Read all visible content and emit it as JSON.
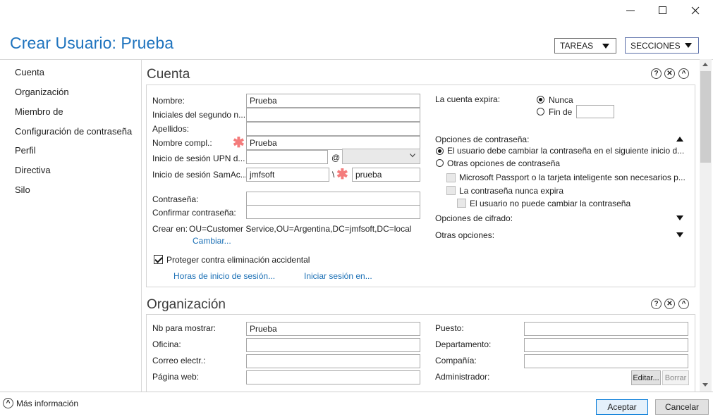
{
  "window": {
    "minimize": "—",
    "maximize": "□",
    "close": "✕"
  },
  "header": {
    "title": "Crear Usuario: Prueba",
    "tasks_label": "TAREAS",
    "sections_label": "SECCIONES"
  },
  "nav": {
    "items": [
      {
        "label": "Cuenta"
      },
      {
        "label": "Organización"
      },
      {
        "label": "Miembro de"
      },
      {
        "label": "Configuración de contraseña"
      },
      {
        "label": "Perfil"
      },
      {
        "label": "Directiva"
      },
      {
        "label": "Silo"
      }
    ]
  },
  "section_icons": {
    "help": "?",
    "close": "✕",
    "collapse": "^"
  },
  "cuenta": {
    "title": "Cuenta",
    "fields": {
      "nombre": {
        "label": "Nombre:",
        "value": "Prueba"
      },
      "iniciales": {
        "label": "Iniciales del segundo n...",
        "value": ""
      },
      "apellidos": {
        "label": "Apellidos:",
        "value": ""
      },
      "nombre_compl": {
        "label": "Nombre compl.:",
        "value": "Prueba"
      },
      "upn": {
        "label": "Inicio de sesión UPN d...",
        "value": "",
        "at": "@",
        "domain": ""
      },
      "sam": {
        "label": "Inicio de sesión SamAc...",
        "domain": "jmfsoft",
        "sep": "\\",
        "value": "prueba"
      },
      "password": {
        "label": "Contraseña:",
        "value": ""
      },
      "confirm_password": {
        "label": "Confirmar contraseña:",
        "value": ""
      }
    },
    "crear_en": {
      "label": "Crear en:",
      "value": "OU=Customer Service,OU=Argentina,DC=jmfsoft,DC=local",
      "change_link": "Cambiar..."
    },
    "protect": {
      "label": "Proteger contra eliminación accidental",
      "checked": true
    },
    "links": {
      "logon_hours": "Horas de inicio de sesión...",
      "logon_to": "Iniciar sesión en..."
    },
    "expires": {
      "label": "La cuenta expira:",
      "never": "Nunca",
      "end_of": "Fin de",
      "end_of_value": "",
      "selected": "never"
    },
    "password_options": {
      "title": "Opciones de contraseña:",
      "must_change": "El usuario debe cambiar la contraseña en el siguiente inicio d...",
      "other": "Otras opciones de contraseña",
      "smartcard": "Microsoft Passport o la tarjeta inteligente son necesarios p...",
      "never_expires": "La contraseña nunca expira",
      "cannot_change": "El usuario no puede cambiar la contraseña",
      "selected": "must_change"
    },
    "encryption_options": "Opciones de cifrado:",
    "other_options": "Otras opciones:"
  },
  "organizacion": {
    "title": "Organización",
    "display_name": {
      "label": "Nb para mostrar:",
      "value": "Prueba"
    },
    "office": {
      "label": "Oficina:",
      "value": ""
    },
    "email": {
      "label": "Correo electr.:",
      "value": ""
    },
    "web": {
      "label": "Página web:",
      "value": ""
    },
    "job_title": {
      "label": "Puesto:",
      "value": ""
    },
    "department": {
      "label": "Departamento:",
      "value": ""
    },
    "company": {
      "label": "Compañía:",
      "value": ""
    },
    "manager": {
      "label": "Administrador:",
      "edit": "Editar...",
      "clear": "Borrar"
    }
  },
  "footer": {
    "more_info": "Más información",
    "accept": "Aceptar",
    "cancel": "Cancelar"
  },
  "colors": {
    "accent": "#1e73be",
    "link": "#1a6fb5",
    "required": "#f47c7c",
    "primary_button_border": "#0078d7"
  }
}
